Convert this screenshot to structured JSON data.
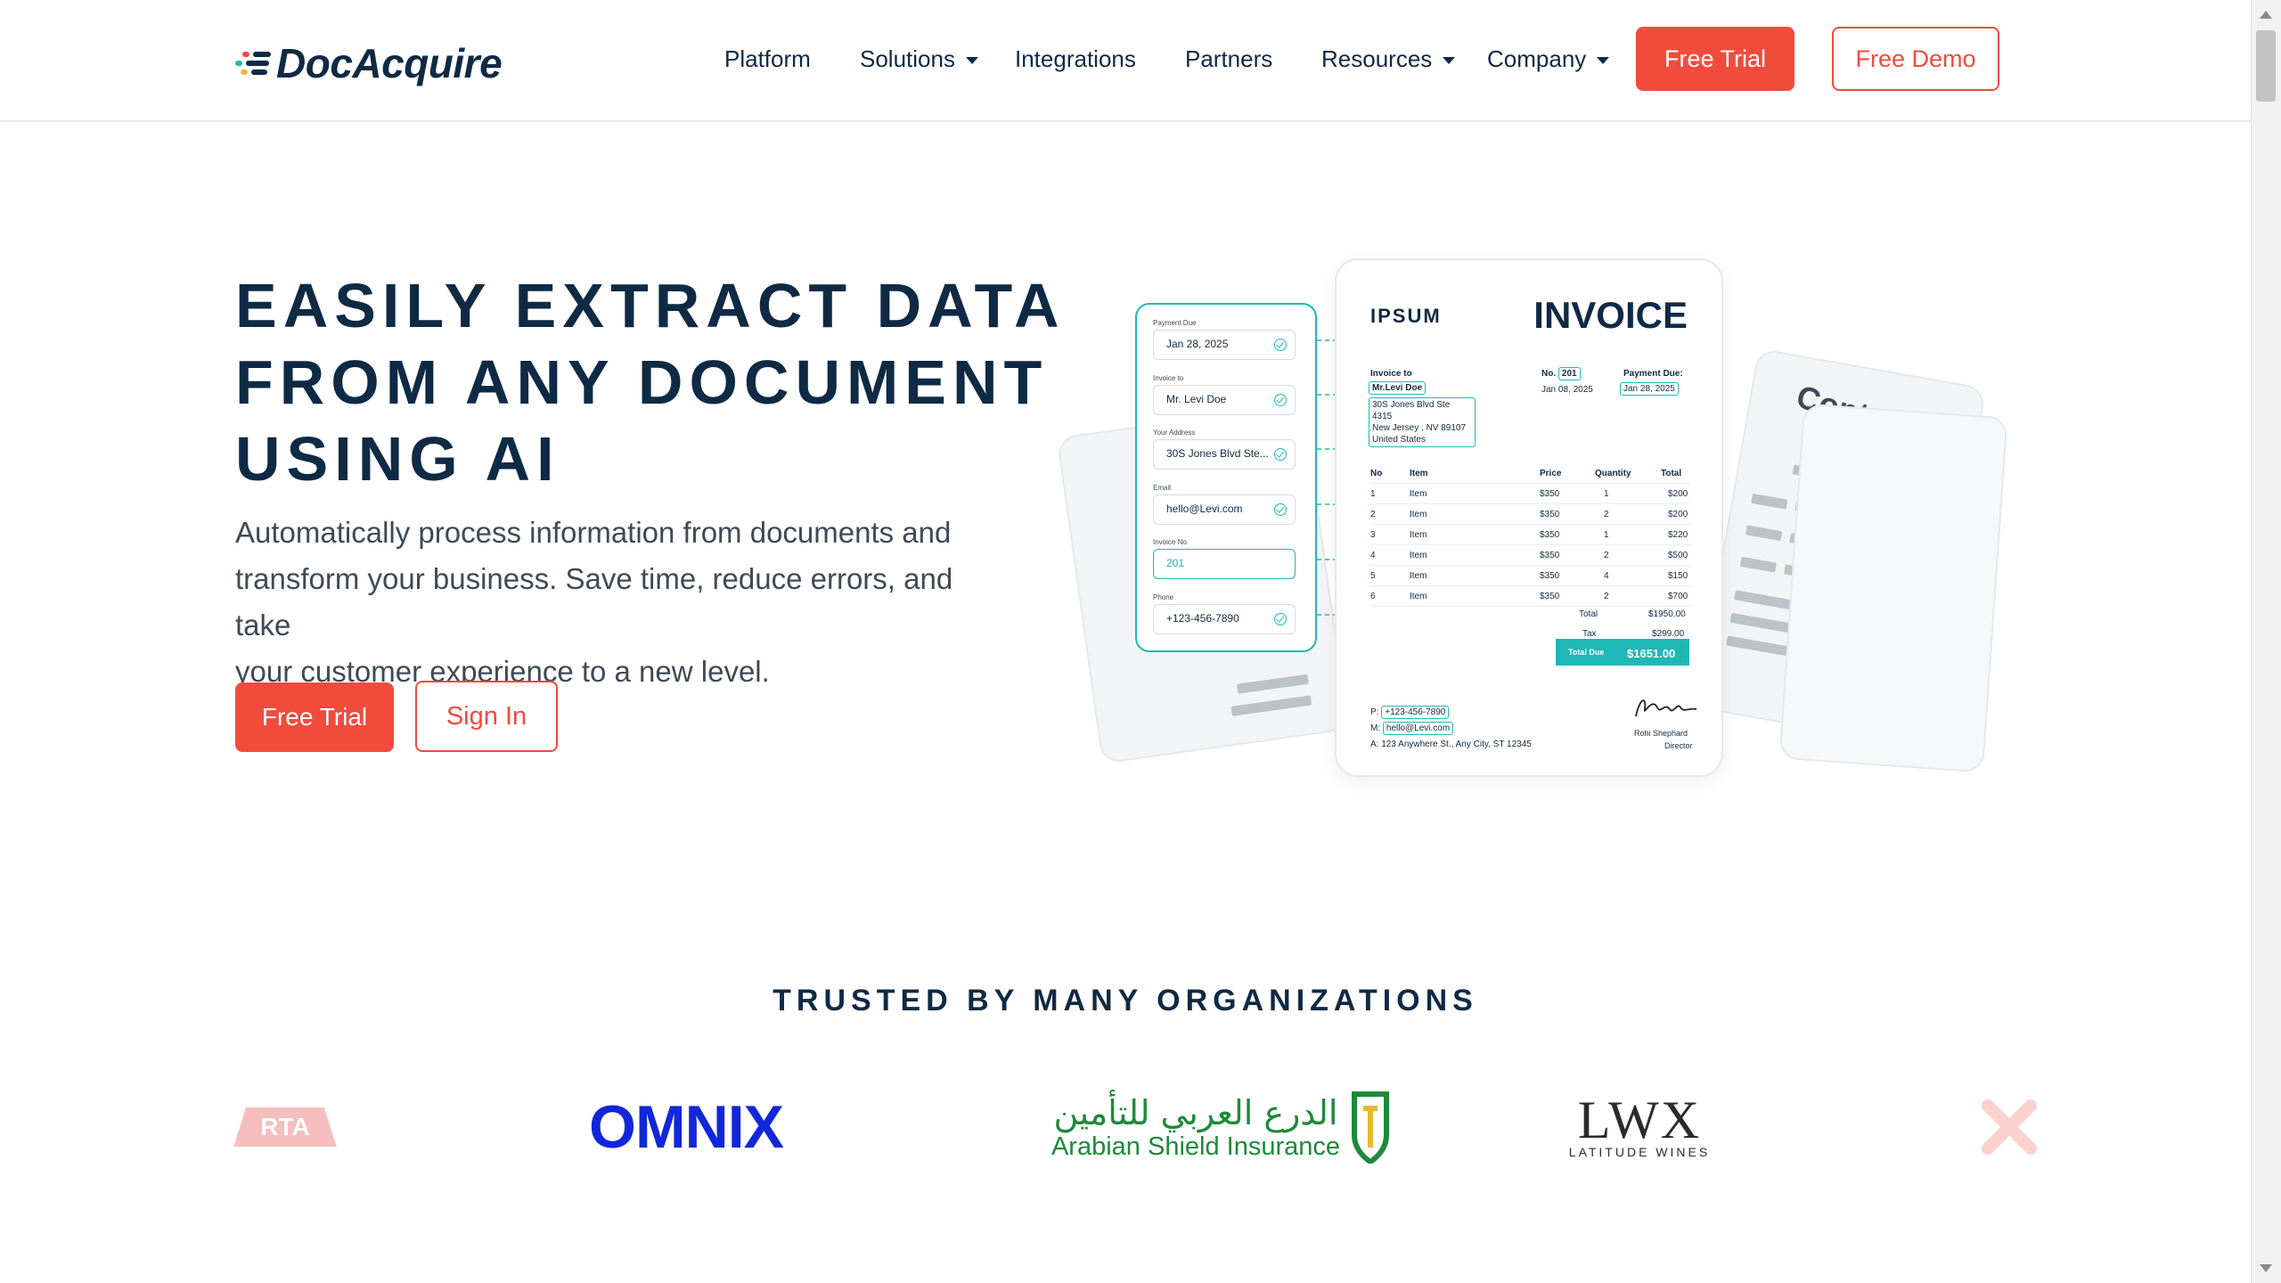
{
  "brand": {
    "name": "DocAcquire"
  },
  "nav": {
    "items": [
      {
        "label": "Platform",
        "has_dropdown": false
      },
      {
        "label": "Solutions",
        "has_dropdown": true
      },
      {
        "label": "Integrations",
        "has_dropdown": false
      },
      {
        "label": "Partners",
        "has_dropdown": false
      },
      {
        "label": "Resources",
        "has_dropdown": true
      },
      {
        "label": "Company",
        "has_dropdown": true
      }
    ],
    "free_trial": "Free Trial",
    "free_demo": "Free Demo"
  },
  "hero": {
    "title_lines": [
      "EASILY EXTRACT DATA",
      "FROM ANY DOCUMENT",
      "USING AI"
    ],
    "subtitle_lines": [
      "Automatically process information from documents and",
      "transform your business. Save time, reduce errors, and take",
      "your customer experience to a new level."
    ],
    "primary_cta": "Free Trial",
    "secondary_cta": "Sign In"
  },
  "illustration": {
    "form_fields": [
      {
        "label": "Payment Due",
        "value": "Jan 28, 2025",
        "checked": true
      },
      {
        "label": "Invoice to",
        "value": "Mr. Levi Doe",
        "checked": true
      },
      {
        "label": "Your Address",
        "value": "30S Jones Blvd Ste...",
        "checked": true
      },
      {
        "label": "Email",
        "value": "hello@Levi.com",
        "checked": true
      },
      {
        "label": "Invoice No.",
        "value": "201",
        "checked": false
      },
      {
        "label": "Phone",
        "value": "+123-456-7890",
        "checked": true
      }
    ],
    "invoice": {
      "brand": "IPSUM",
      "title": "INVOICE",
      "invoice_to_label": "Invoice to",
      "invoice_to_name": "Mr.Levi Doe",
      "address_lines": [
        "30S Jones Blvd Ste 4315",
        "New Jersey , NV 89107",
        "United States"
      ],
      "no_label": "No.",
      "no_value": "201",
      "date": "Jan 08, 2025",
      "payment_due_label": "Payment Due:",
      "payment_due_value": "Jan 28, 2025",
      "columns": [
        "No",
        "Item",
        "Price",
        "Quantity",
        "Total"
      ],
      "rows": [
        [
          "1",
          "Item",
          "$350",
          "1",
          "$200"
        ],
        [
          "2",
          "Item",
          "$350",
          "2",
          "$200"
        ],
        [
          "3",
          "Item",
          "$350",
          "1",
          "$220"
        ],
        [
          "4",
          "Item",
          "$350",
          "2",
          "$500"
        ],
        [
          "5",
          "Item",
          "$350",
          "4",
          "$150"
        ],
        [
          "6",
          "Item",
          "$350",
          "2",
          "$700"
        ]
      ],
      "total_label": "Total",
      "total_value": "$1950.00",
      "tax_label": "Tax",
      "tax_value": "$299.00",
      "total_due_label": "Total Due",
      "total_due_value": "$1651.00",
      "phone": "+123-456-7890",
      "email": "hello@Levi.com",
      "address": "123 Anywhere St., Any City, ST 12345",
      "footer_p": "P:",
      "footer_m": "M:",
      "footer_a": "A:",
      "signer_name": "Rohi Shephard",
      "signer_role": "Director"
    },
    "contract_label": "Contract"
  },
  "trusted": {
    "heading": "TRUSTED BY MANY ORGANIZATIONS",
    "logos": {
      "rta": "RTA",
      "omnix": "OMNIX",
      "asi_arabic": "الدرع العربي للتأمين",
      "asi_english": "Arabian Shield Insurance",
      "lwx": "LWX",
      "lwx_sub": "LATITUDE WINES"
    }
  },
  "colors": {
    "primary": "#f14b3e",
    "navy": "#0f2a44",
    "teal": "#1fb8b6",
    "omnix_blue": "#1227d9",
    "asi_green": "#1d8a3a"
  }
}
